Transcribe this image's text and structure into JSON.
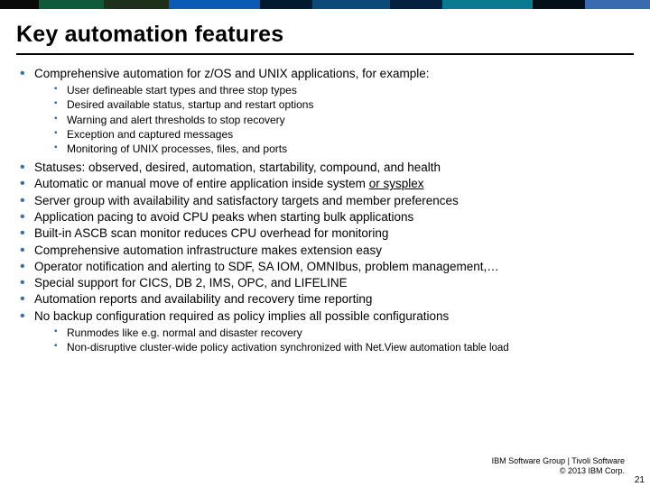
{
  "strip_colors": [
    {
      "w": "6%",
      "c": "#0a0a0a"
    },
    {
      "w": "10%",
      "c": "#0f5a3a"
    },
    {
      "w": "10%",
      "c": "#1e2f1a"
    },
    {
      "w": "14%",
      "c": "#0a5bb5"
    },
    {
      "w": "8%",
      "c": "#021a30"
    },
    {
      "w": "12%",
      "c": "#0c4a7a"
    },
    {
      "w": "8%",
      "c": "#062040"
    },
    {
      "w": "14%",
      "c": "#0a7a90"
    },
    {
      "w": "8%",
      "c": "#031018"
    },
    {
      "w": "10%",
      "c": "#3a6bb0"
    }
  ],
  "title": "Key automation features",
  "bullets_lvl1_before_sub": "Comprehensive automation for z/OS and UNIX applications, for example:",
  "sub_a": [
    "User defineable start types and three stop types",
    "Desired available status, startup and restart options",
    "Warning and alert thresholds to stop recovery",
    "Exception and captured messages",
    "Monitoring of UNIX processes, files, and ports"
  ],
  "mid": [
    "Statuses: observed, desired, automation, startability, compound, and health",
    "Automatic or manual move of entire application inside system ",
    "Server group with availability and satisfactory targets and member preferences",
    "Application pacing to avoid CPU peaks when starting bulk applications",
    "Built-in ASCB scan monitor reduces CPU overhead for monitoring",
    "Comprehensive automation infrastructure makes extension easy",
    "Operator notification and alerting to SDF, SA IOM, OMNIbus, problem management,…",
    "Special support for CICS, DB 2, IMS, OPC, and LIFELINE",
    "Automation reports and availability and recovery time reporting",
    "No backup configuration required as policy implies all possible configurations"
  ],
  "mid_underline_suffix": "or sysplex",
  "sub_b": [
    "Runmodes like e.g. normal and disaster recovery",
    "Non-disruptive cluster-wide policy activation "
  ],
  "sub_b_tail": "synchronized with Net.View automation table load",
  "footer_line1": "IBM Software Group | Tivoli Software",
  "footer_line2": "© 2013 IBM Corp.",
  "page_number": "21"
}
